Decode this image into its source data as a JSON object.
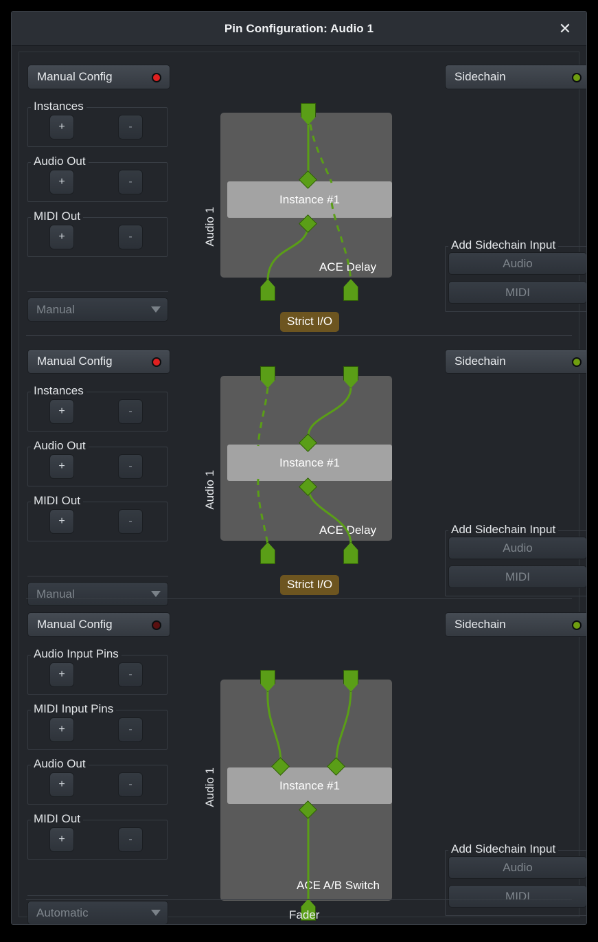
{
  "window": {
    "title": "Pin Configuration: Audio 1",
    "close_icon": "close-icon"
  },
  "colors": {
    "led_red_on": "#e02020",
    "led_red_off": "#5a1010",
    "led_green_on": "#6f9e10",
    "pin_green": "#5a9e17",
    "wire_green": "#5a9e17",
    "strict_io_badge": "#6d5520",
    "graph_box": "#5a5a5a",
    "instance_bar": "#a3a3a3"
  },
  "sections": [
    {
      "id": "section-1",
      "config_button": {
        "label": "Manual Config",
        "led": "on"
      },
      "groups": [
        {
          "label": "Instances",
          "plus": "+",
          "minus": "-"
        },
        {
          "label": "Audio Out",
          "plus": "+",
          "minus": "-"
        },
        {
          "label": "MIDI Out",
          "plus": "+",
          "minus": "-"
        }
      ],
      "combo": {
        "value": "Manual"
      },
      "graph": {
        "side_label": "Audio 1",
        "instance_label": "Instance #1",
        "plugin_name": "ACE Delay",
        "badge": "Strict I/O",
        "inputs": 1,
        "outputs": 2,
        "node_inputs": 1,
        "node_outputs": 1
      },
      "sidechain": {
        "label": "Sidechain",
        "led": "on"
      },
      "add_sidechain": {
        "label": "Add Sidechain Input",
        "audio": "Audio",
        "midi": "MIDI"
      }
    },
    {
      "id": "section-2",
      "config_button": {
        "label": "Manual Config",
        "led": "on"
      },
      "groups": [
        {
          "label": "Instances",
          "plus": "+",
          "minus": "-"
        },
        {
          "label": "Audio Out",
          "plus": "+",
          "minus": "-"
        },
        {
          "label": "MIDI Out",
          "plus": "+",
          "minus": "-"
        }
      ],
      "combo": {
        "value": "Manual"
      },
      "graph": {
        "side_label": "Audio 1",
        "instance_label": "Instance #1",
        "plugin_name": "ACE Delay",
        "badge": "Strict I/O",
        "inputs": 2,
        "outputs": 2,
        "node_inputs": 1,
        "node_outputs": 1
      },
      "sidechain": {
        "label": "Sidechain",
        "led": "on"
      },
      "add_sidechain": {
        "label": "Add Sidechain Input",
        "audio": "Audio",
        "midi": "MIDI"
      }
    },
    {
      "id": "section-3",
      "config_button": {
        "label": "Manual Config",
        "led": "off"
      },
      "groups": [
        {
          "label": "Audio Input Pins",
          "plus": "+",
          "minus": "-"
        },
        {
          "label": "MIDI Input Pins",
          "plus": "+",
          "minus": "-"
        },
        {
          "label": "Audio Out",
          "plus": "+",
          "minus": "-"
        },
        {
          "label": "MIDI Out",
          "plus": "+",
          "minus": "-"
        }
      ],
      "combo": {
        "value": "Automatic"
      },
      "graph": {
        "side_label": "Audio 1",
        "instance_label": "Instance #1",
        "plugin_name": "ACE A/B Switch",
        "badge": "",
        "inputs": 2,
        "outputs": 1,
        "node_inputs": 2,
        "node_outputs": 1
      },
      "sidechain": {
        "label": "Sidechain",
        "led": "on"
      },
      "add_sidechain": {
        "label": "Add Sidechain Input",
        "audio": "Audio",
        "midi": "MIDI"
      }
    }
  ],
  "footer": {
    "label": "Fader"
  }
}
